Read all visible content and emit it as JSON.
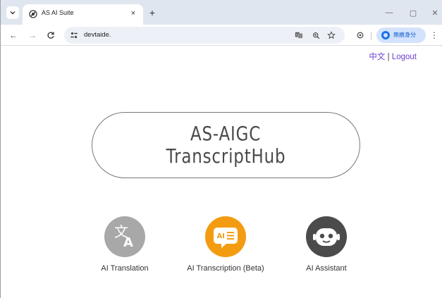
{
  "browser": {
    "tab": {
      "title": "AS AI Suite",
      "close_glyph": "×"
    },
    "new_tab_glyph": "+",
    "window_controls": {
      "minimize": "—",
      "maximize": "▢",
      "close": "✕"
    },
    "nav": {
      "back": "←",
      "forward": "→"
    },
    "address": {
      "url": "devtaide."
    },
    "profile": {
      "label": "無痕身分"
    },
    "menu_glyph": "⋮",
    "icons": [
      "tab-search-icon",
      "favicon-icon",
      "reload-icon",
      "site-info-icon",
      "translate-icon",
      "zoom-icon",
      "star-icon",
      "extension-icon"
    ]
  },
  "page": {
    "top_links": {
      "language": "中文",
      "separator": "|",
      "logout": "Logout"
    },
    "hero": {
      "line1": "AS-AIGC",
      "line2": "TranscriptHub"
    },
    "features": [
      {
        "label": "AI Translation",
        "icon": "translate-icon",
        "color": "#a8a8a8"
      },
      {
        "label": "AI Transcription (Beta)",
        "icon": "ai-transcription-icon",
        "color": "#f39c12"
      },
      {
        "label": "AI Assistant",
        "icon": "robot-icon",
        "color": "#4b4b4b"
      }
    ]
  }
}
